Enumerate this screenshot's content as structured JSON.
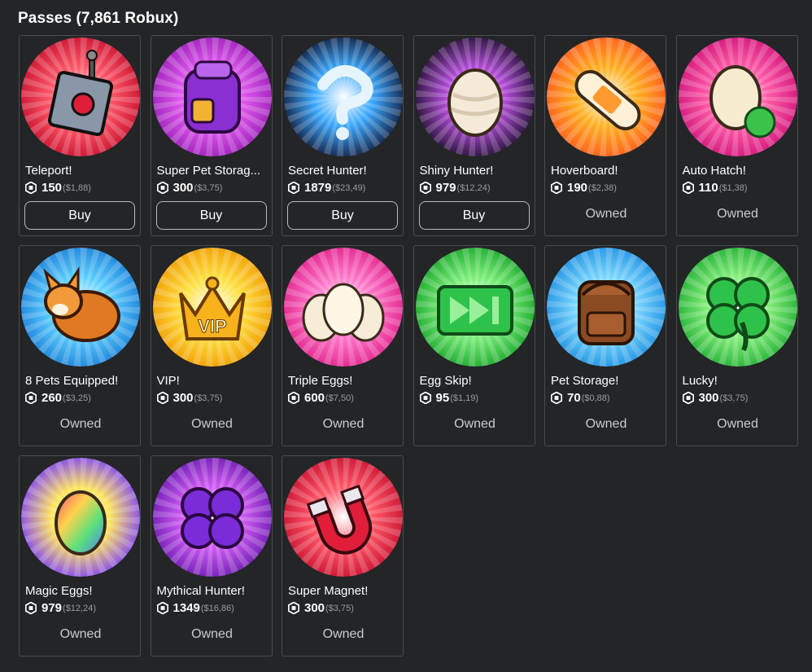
{
  "header": {
    "title": "Passes (7,861 Robux)"
  },
  "passes": [
    {
      "name": "Teleport!",
      "price": "150",
      "usd": "($1,88)",
      "status": "Buy",
      "icon": "teleport-remote-icon",
      "colors": [
        "#ff5a6a",
        "#c8102e"
      ]
    },
    {
      "name": "Super Pet Storag...",
      "price": "300",
      "usd": "($3,75)",
      "status": "Buy",
      "icon": "backpack-icon",
      "colors": [
        "#e35cf0",
        "#9a1fb8"
      ]
    },
    {
      "name": "Secret Hunter!",
      "price": "1879",
      "usd": "($23,49)",
      "status": "Buy",
      "icon": "question-swirl-icon",
      "colors": [
        "#3aa8ff",
        "#101a3a"
      ]
    },
    {
      "name": "Shiny Hunter!",
      "price": "979",
      "usd": "($12,24)",
      "status": "Buy",
      "icon": "shiny-egg-icon",
      "colors": [
        "#b24bd8",
        "#1e0f2e"
      ]
    },
    {
      "name": "Hoverboard!",
      "price": "190",
      "usd": "($2,38)",
      "status": "Owned",
      "icon": "hoverboard-icon",
      "colors": [
        "#ffb020",
        "#ff5a1f"
      ]
    },
    {
      "name": "Auto Hatch!",
      "price": "110",
      "usd": "($1,38)",
      "status": "Owned",
      "icon": "egg-recycle-icon",
      "colors": [
        "#ff5ca8",
        "#d1147a"
      ]
    },
    {
      "name": "8 Pets Equipped!",
      "price": "260",
      "usd": "($3,25)",
      "status": "Owned",
      "icon": "corgi-pet-icon",
      "colors": [
        "#5fd0ff",
        "#1a7fd8"
      ]
    },
    {
      "name": "VIP!",
      "price": "300",
      "usd": "($3,75)",
      "status": "Owned",
      "icon": "vip-crown-icon",
      "colors": [
        "#ffe040",
        "#f09a00"
      ]
    },
    {
      "name": "Triple Eggs!",
      "price": "600",
      "usd": "($7,50)",
      "status": "Owned",
      "icon": "triple-eggs-icon",
      "colors": [
        "#ff7acb",
        "#e0218a"
      ]
    },
    {
      "name": "Egg Skip!",
      "price": "95",
      "usd": "($1,19)",
      "status": "Owned",
      "icon": "fast-forward-icon",
      "colors": [
        "#7cf07a",
        "#18a52a"
      ]
    },
    {
      "name": "Pet Storage!",
      "price": "70",
      "usd": "($0,88)",
      "status": "Owned",
      "icon": "brown-backpack-icon",
      "colors": [
        "#7ad8ff",
        "#1d8fe0"
      ]
    },
    {
      "name": "Lucky!",
      "price": "300",
      "usd": "($3,75)",
      "status": "Owned",
      "icon": "clover-icon",
      "colors": [
        "#86f07c",
        "#1fae32"
      ]
    },
    {
      "name": "Magic Eggs!",
      "price": "979",
      "usd": "($12,24)",
      "status": "Owned",
      "icon": "rainbow-egg-icon",
      "colors": [
        "#ffe45a",
        "#7a3cff"
      ]
    },
    {
      "name": "Mythical Hunter!",
      "price": "1349",
      "usd": "($16,86)",
      "status": "Owned",
      "icon": "purple-clover-icon",
      "colors": [
        "#d25cf5",
        "#6a1bb0"
      ]
    },
    {
      "name": "Super Magnet!",
      "price": "300",
      "usd": "($3,75)",
      "status": "Owned",
      "icon": "magnet-icon",
      "colors": [
        "#ff5a6a",
        "#c8102e"
      ]
    }
  ]
}
